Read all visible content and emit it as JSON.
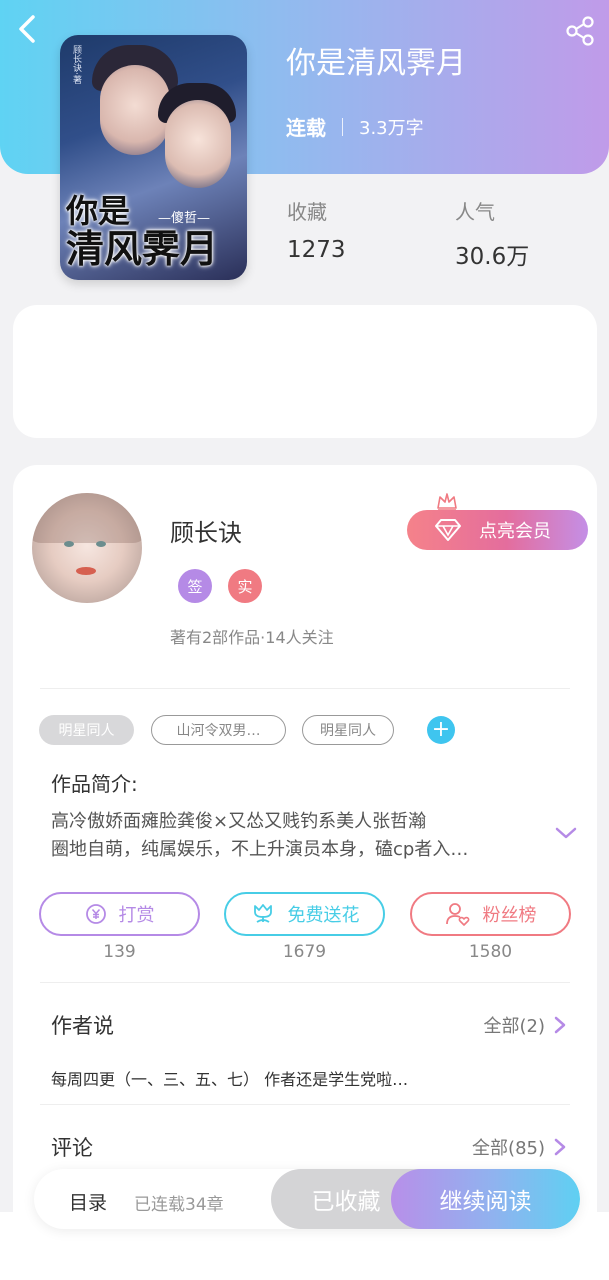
{
  "book": {
    "title": "你是清风霁月",
    "status": "连载",
    "word_count": "3.3万字",
    "cover": {
      "title_line1": "你是",
      "title_line2": "清风霁月",
      "author_tag": "—傻哲—",
      "small_text": "顾长诀·著"
    },
    "stats": {
      "favorites_label": "收藏",
      "favorites_value": "1273",
      "popularity_label": "人气",
      "popularity_value": "30.6万"
    }
  },
  "author": {
    "name": "顾长诀",
    "badge_signed": "签",
    "badge_verified": "实",
    "meta": "著有2部作品·14人关注",
    "vip_button": "点亮会员"
  },
  "tags": [
    "明星同人",
    "山河令双男…",
    "明星同人"
  ],
  "intro": {
    "title": "作品简介:",
    "line1": "高冷傲娇面瘫脸龚俊×又怂又贱钓系美人张哲瀚",
    "line2": "圈地自萌，纯属娱乐，不上升演员本身，磕cp者入…"
  },
  "actions": {
    "reward_label": "打赏",
    "reward_count": "139",
    "flower_label": "免费送花",
    "flower_count": "1679",
    "fans_label": "粉丝榜",
    "fans_count": "1580"
  },
  "author_says": {
    "title": "作者说",
    "all_label": "全部(2)",
    "text": "每周四更（一、三、五、七） 作者还是学生党啦…"
  },
  "comments": {
    "title": "评论",
    "all_label": "全部(85)"
  },
  "bottom_bar": {
    "toc_label": "目录",
    "chapters": "已连载34章",
    "collected_label": "已收藏",
    "read_label": "继续阅读"
  },
  "colors": {
    "header_gradient_start": "#5fd3f3",
    "header_gradient_end": "#c09be9",
    "purple": "#b58ae6",
    "cyan": "#47cde6",
    "pink": "#f07a82"
  }
}
